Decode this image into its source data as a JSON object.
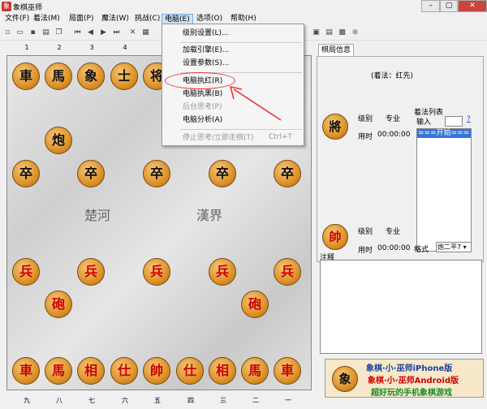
{
  "window": {
    "title": "象棋巫师",
    "min": "–",
    "max": "▢",
    "close": "✕"
  },
  "menus": [
    "文件(F)",
    "着法(M)",
    "局面(P)",
    "魔法(W)",
    "挑战(C)",
    "电脑(E)",
    "选项(O)",
    "帮助(H)"
  ],
  "dropdown": {
    "items": [
      {
        "label": "级别设置(L)...",
        "disabled": false
      },
      {
        "label": "加载引擎(E)...",
        "disabled": false
      },
      {
        "label": "设置参数(S)...",
        "disabled": false
      },
      {
        "label": "电脑执红(R)",
        "disabled": false
      },
      {
        "label": "电脑执黑(B)",
        "disabled": false
      },
      {
        "label": "后台思考(P)",
        "disabled": true
      },
      {
        "label": "电脑分析(A)",
        "disabled": false
      },
      {
        "label": "停止思考/立即走棋(T)",
        "disabled": true,
        "shortcut": "Ctrl+T"
      }
    ]
  },
  "board": {
    "top_numbers": [
      "1",
      "2",
      "3",
      "4",
      "5",
      "6",
      "7",
      "8",
      "9"
    ],
    "bottom_numbers": [
      "九",
      "八",
      "七",
      "六",
      "五",
      "四",
      "三",
      "二",
      "一"
    ],
    "river_left": "楚河",
    "river_right": "漢界",
    "black_back": [
      "車",
      "馬",
      "象",
      "士",
      "将"
    ],
    "black_cannon": "炮",
    "black_pawn": "卒",
    "red_pawn": "兵",
    "red_cannon": "砲",
    "red_back": [
      "車",
      "馬",
      "相",
      "仕",
      "帥",
      "仕",
      "相",
      "馬",
      "車"
    ]
  },
  "panel": {
    "tab": "棋局信息",
    "caption": "(着法：红先)",
    "black_piece": "將",
    "red_piece": "帥",
    "level_label": "级别",
    "level_value": "专业",
    "time_label": "用时",
    "time_value": "00:00:00",
    "movelist_label": "着法列表",
    "input_label": "输入",
    "help": "?",
    "move_start": "===开始===",
    "format_label": "格式",
    "format_value": "炮二平7",
    "notes_label": "注释",
    "ad_line1": "象棋·小·巫师iPhone版",
    "ad_line2": "象棋·小·巫师Android版",
    "ad_line3": "超好玩的手机象棋游戏",
    "ad_piece": "象"
  },
  "colors": {
    "accent": "#cfe3f7",
    "highlight": "#e33"
  }
}
